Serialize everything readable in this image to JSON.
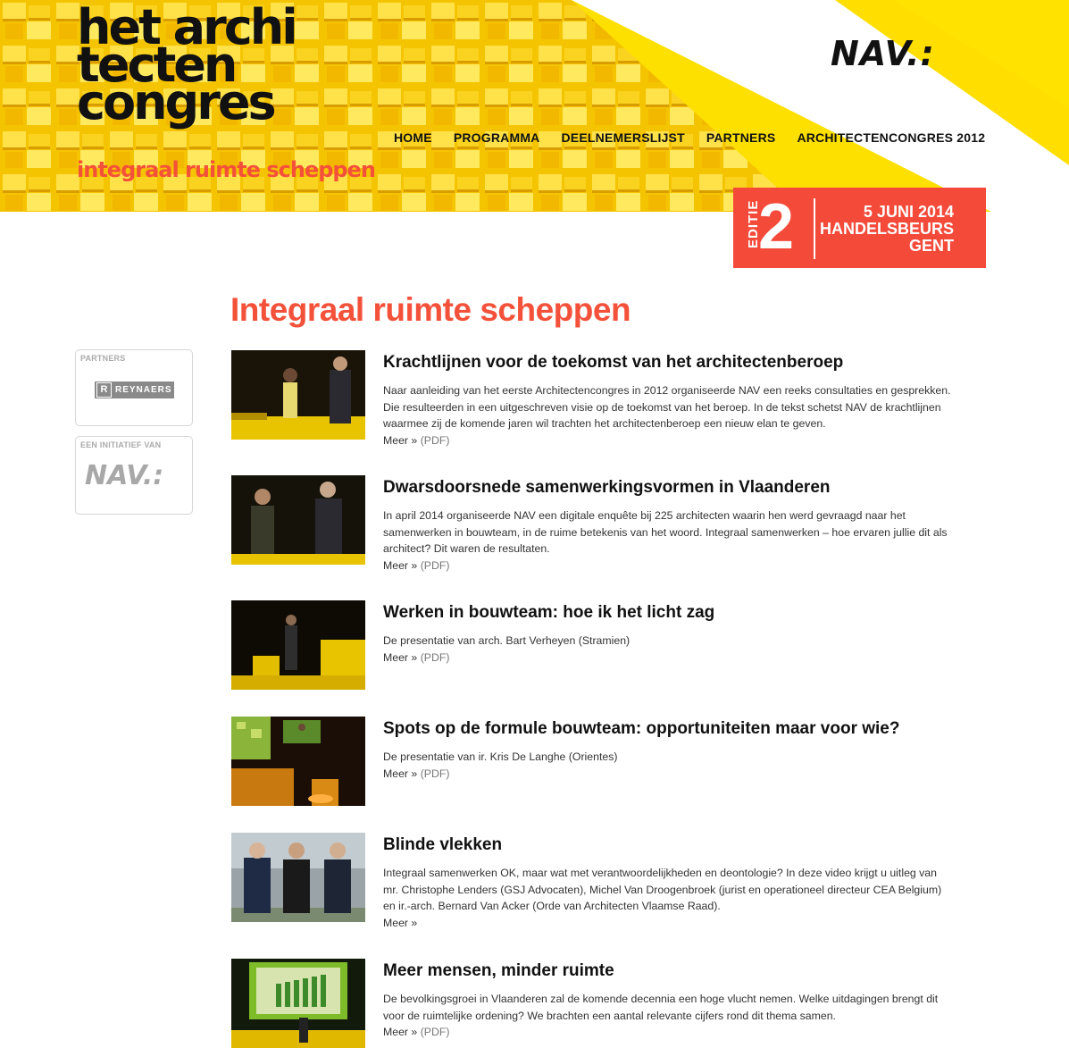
{
  "header": {
    "logo_lines": [
      "het archi",
      "tecten",
      "congres"
    ],
    "tagline": "integraal ruimte scheppen",
    "brand": "NAV.:",
    "nav": [
      "HOME",
      "PROGRAMMA",
      "DEELNEMERSLIJST",
      "PARTNERS",
      "ARCHITECTENCONGRES 2012"
    ],
    "edition": {
      "label": "EDITIE",
      "number": "2",
      "info": [
        "5 JUNI 2014",
        "HANDELSBEURS",
        "GENT"
      ]
    }
  },
  "colors": {
    "accent": "#f4513a",
    "yellow": "#f7d21c",
    "edition_bg": "#f44a3a"
  },
  "main": {
    "title": "Integraal ruimte scheppen"
  },
  "sidebar": {
    "partners_label": "PARTNERS",
    "partner_name": "REYNAERS",
    "partner_mark": "R",
    "initiative_label": "EEN INITIATIEF VAN",
    "initiative_logo": "NAV.:"
  },
  "articles": [
    {
      "title": "Krachtlijnen voor de toekomst van het architectenberoep",
      "text": "Naar aanleiding van het eerste Architectencongres in 2012 organiseerde NAV een reeks consultaties en gesprekken. Die resulteerden in een uitgeschreven visie op de toekomst van het beroep. In de tekst schetst NAV de krachtlijnen waarmee zij de komende jaren wil trachten het architectenberoep een nieuw elan te geven.",
      "more": "Meer »",
      "pdf": "(PDF)"
    },
    {
      "title": "Dwarsdoorsnede samenwerkingsvormen in Vlaanderen",
      "text": "In april 2014 organiseerde NAV een digitale enquête bij 225 architecten waarin hen werd gevraagd naar het samenwerken in bouwteam, in de ruime betekenis van het woord. Integraal samenwerken – hoe ervaren jullie dit als architect? Dit waren de resultaten.",
      "more": "Meer »",
      "pdf": "(PDF)"
    },
    {
      "title": "Werken in bouwteam: hoe ik het licht zag",
      "text": "De presentatie van arch. Bart Verheyen (Stramien)",
      "more": "Meer »",
      "pdf": "(PDF)"
    },
    {
      "title": "Spots op de formule bouwteam: opportuniteiten maar voor wie?",
      "text": "De presentatie van ir. Kris De Langhe (Orientes)",
      "more": "Meer »",
      "pdf": "(PDF)"
    },
    {
      "title": "Blinde vlekken",
      "text": "Integraal samenwerken OK, maar wat met verantwoordelijkheden en deontologie? In deze video krijgt u uitleg van mr. Christophe Lenders (GSJ Advocaten), Michel Van Droogenbroek (jurist en operationeel directeur CEA Belgium) en ir.-arch. Bernard Van Acker (Orde van Architecten Vlaamse Raad).",
      "more": "Meer »",
      "pdf": ""
    },
    {
      "title": "Meer mensen, minder ruimte",
      "text": "De bevolkingsgroei in Vlaanderen zal de komende decennia een hoge vlucht nemen. Welke uitdagingen brengt dit voor de ruimtelijke ordening? We brachten een aantal relevante cijfers rond dit thema samen.",
      "more": "Meer »",
      "pdf": "(PDF)"
    }
  ]
}
